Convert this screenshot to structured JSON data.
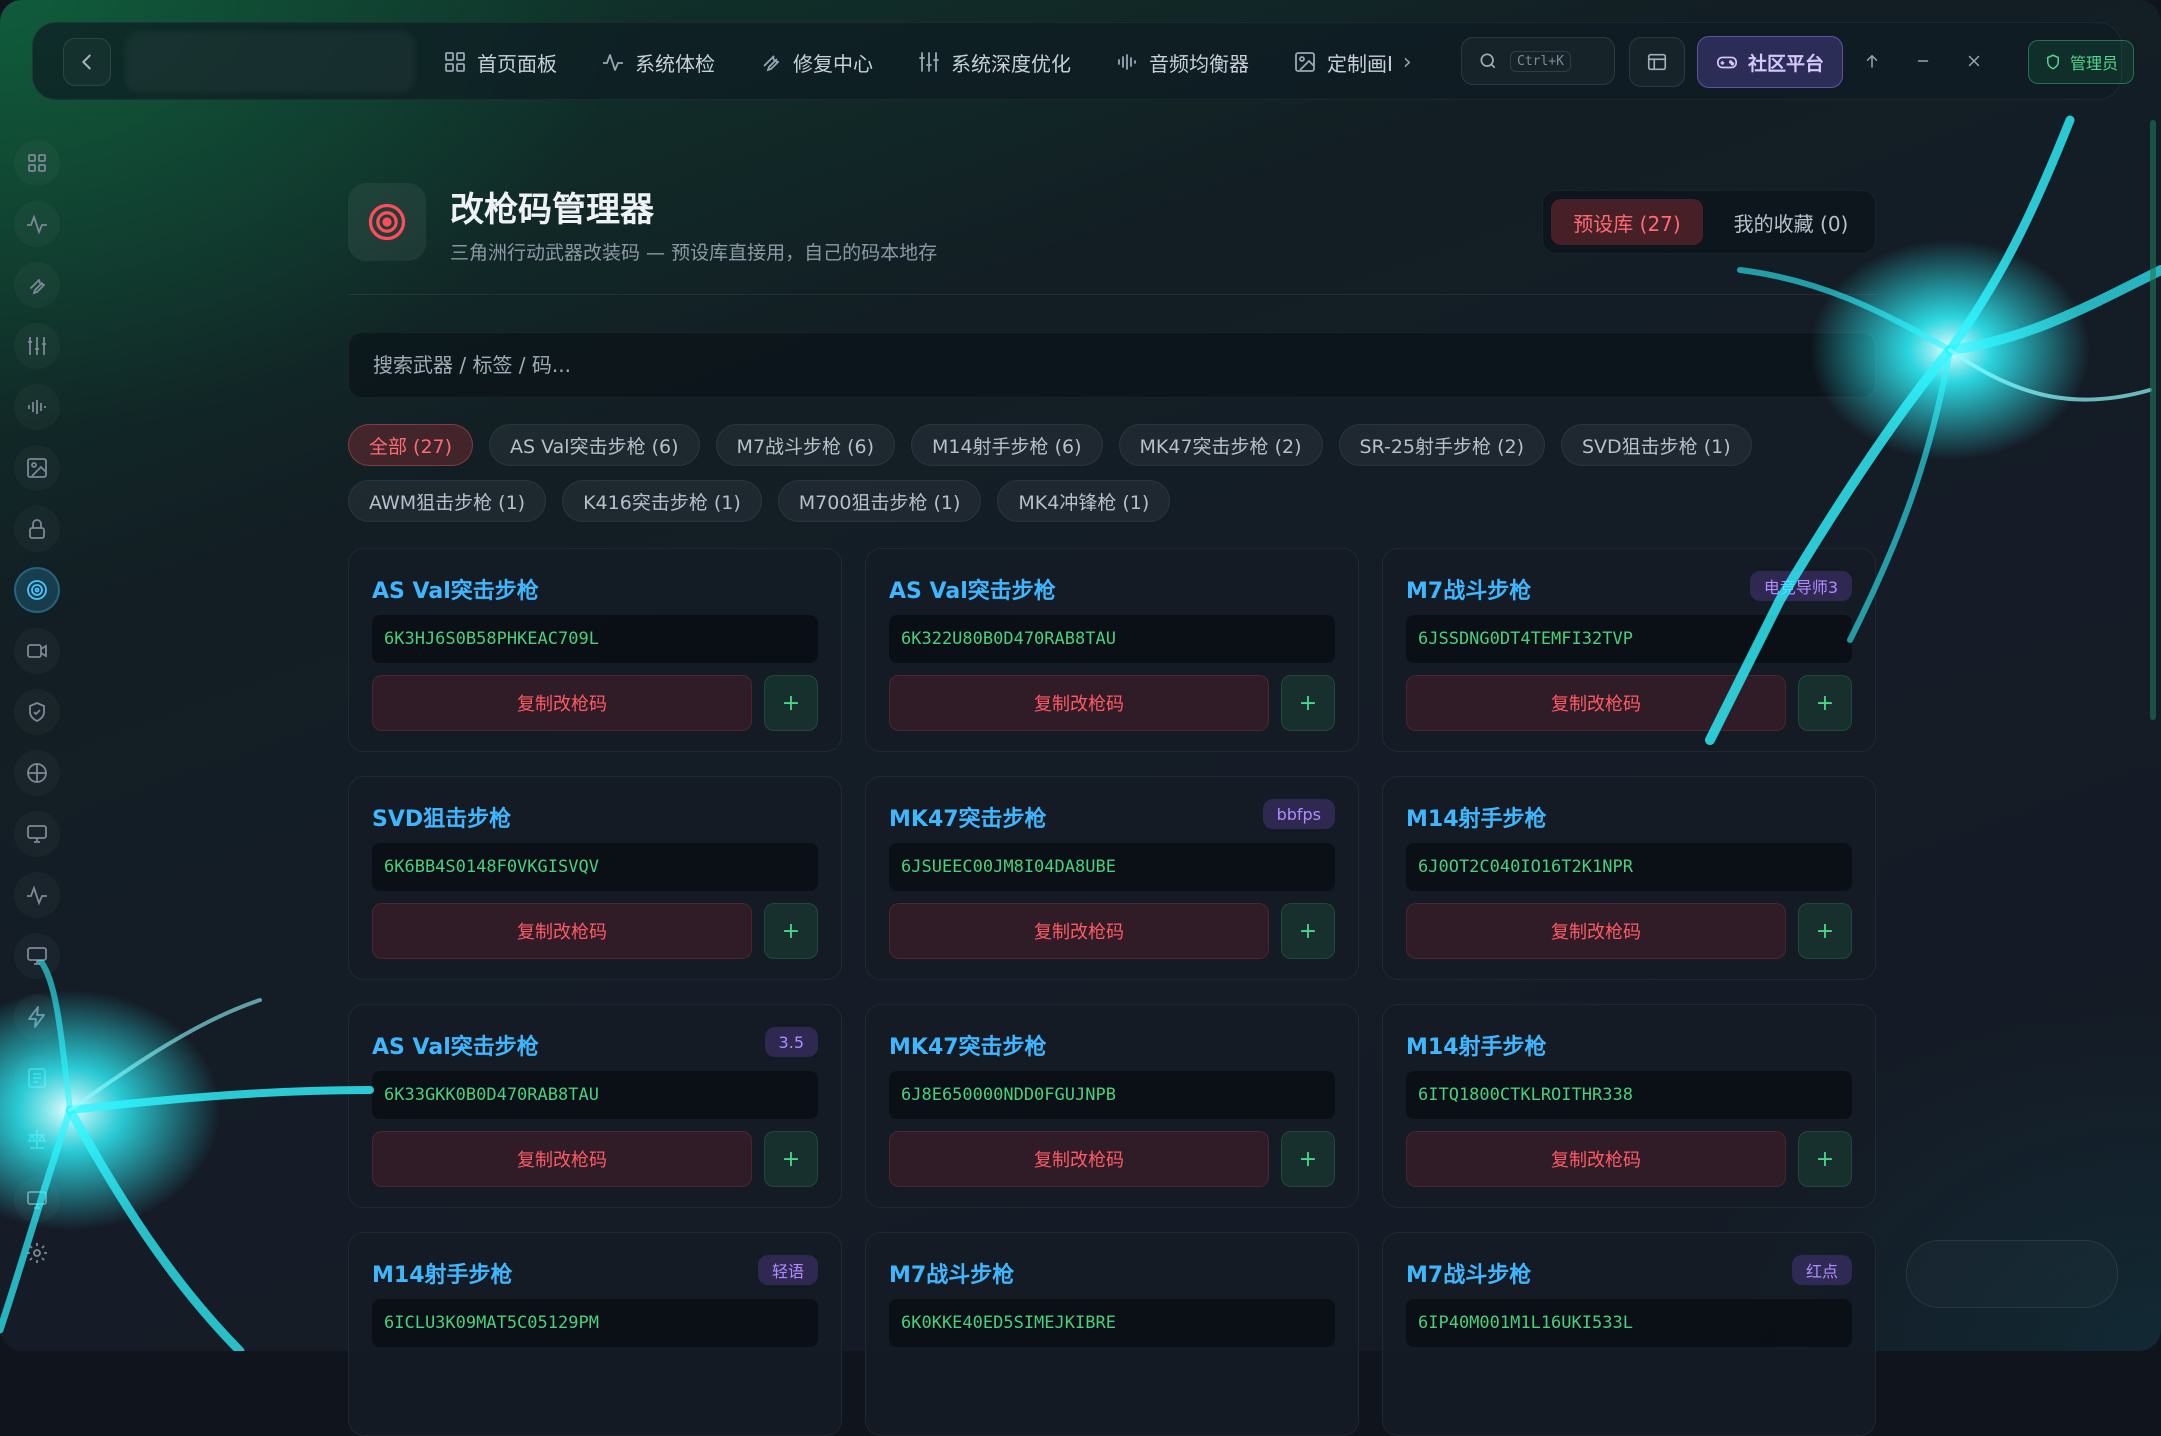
{
  "topbar": {
    "nav": [
      {
        "label": "首页面板",
        "icon": "grid-icon"
      },
      {
        "label": "系统体检",
        "icon": "pulse-icon"
      },
      {
        "label": "修复中心",
        "icon": "wrench-icon"
      },
      {
        "label": "系统深度优化",
        "icon": "sliders-icon"
      },
      {
        "label": "音频均衡器",
        "icon": "waveform-icon"
      },
      {
        "label": "定制画I",
        "icon": "image-icon"
      }
    ],
    "search_shortcut": "Ctrl+K",
    "community_label": "社区平台",
    "admin_label": "管理员"
  },
  "header": {
    "title": "改枪码管理器",
    "subtitle": "三角洲行动武器改装码 — 预设库直接用，自己的码本地存",
    "tab_presets": "预设库 (27)",
    "tab_favorites": "我的收藏 (0)"
  },
  "search": {
    "placeholder": "搜索武器 / 标签 / 码..."
  },
  "filters": [
    {
      "label": "全部 (27)",
      "active": true
    },
    {
      "label": "AS Val突击步枪 (6)"
    },
    {
      "label": "M7战斗步枪 (6)"
    },
    {
      "label": "M14射手步枪 (6)"
    },
    {
      "label": "MK47突击步枪 (2)"
    },
    {
      "label": "SR-25射手步枪 (2)"
    },
    {
      "label": "SVD狙击步枪 (1)"
    },
    {
      "label": "AWM狙击步枪 (1)"
    },
    {
      "label": "K416突击步枪 (1)"
    },
    {
      "label": "M700狙击步枪 (1)"
    },
    {
      "label": "MK4冲锋枪 (1)"
    }
  ],
  "cards": [
    {
      "weapon": "AS Val突击步枪",
      "code": "6K3HJ6S0B58PHKEAC709L",
      "tag": ""
    },
    {
      "weapon": "AS Val突击步枪",
      "code": "6K322U80B0D470RAB8TAU",
      "tag": ""
    },
    {
      "weapon": "M7战斗步枪",
      "code": "6JSSDNG0DT4TEMFI32TVP",
      "tag": "电竞导师3"
    },
    {
      "weapon": "SVD狙击步枪",
      "code": "6K6BB4S0148F0VKGISVQV",
      "tag": ""
    },
    {
      "weapon": "MK47突击步枪",
      "code": "6JSUEEC00JM8I04DA8UBE",
      "tag": "bbfps"
    },
    {
      "weapon": "M14射手步枪",
      "code": "6J0OT2C040IO16T2K1NPR",
      "tag": ""
    },
    {
      "weapon": "AS Val突击步枪",
      "code": "6K33GKK0B0D470RAB8TAU",
      "tag": "3.5"
    },
    {
      "weapon": "MK47突击步枪",
      "code": "6J8E650000NDD0FGUJNPB",
      "tag": ""
    },
    {
      "weapon": "M14射手步枪",
      "code": "6ITQ1800CTKLROITHR338",
      "tag": ""
    },
    {
      "weapon": "M14射手步枪",
      "code": "6ICLU3K09MAT5C05129PM",
      "tag": "轻语"
    },
    {
      "weapon": "M7战斗步枪",
      "code": "6K0KKE40ED5SIMEJKIBRE",
      "tag": ""
    },
    {
      "weapon": "M7战斗步枪",
      "code": "6IP40M001M1L16UKI533L",
      "tag": "红点"
    }
  ],
  "card_labels": {
    "copy": "复制改枪码",
    "add": "+"
  },
  "colors": {
    "accent_red": "#ff5a66",
    "accent_blue": "#3fb7ff",
    "code_green": "#47d07e",
    "glow_cyan": "#2ff5ff"
  }
}
